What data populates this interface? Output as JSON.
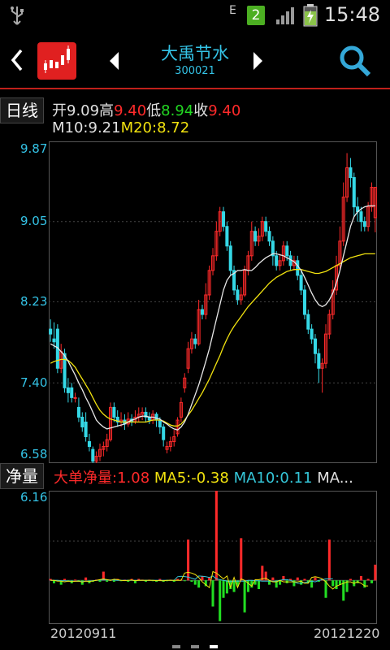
{
  "status": {
    "network": "E",
    "sim_badge": "2",
    "time": "15:48"
  },
  "header": {
    "stock_name": "大禹节水",
    "stock_code": "300021"
  },
  "ohlc": {
    "period_label": "日线",
    "open_label": "开",
    "open_value": "9.09",
    "high_label": "高",
    "high_value": "9.40",
    "low_label": "低",
    "low_value": "8.94",
    "close_label": "收",
    "close_value": "9.40",
    "ma10_label": "M10:",
    "ma10_value": "9.21",
    "ma20_label": "M20:",
    "ma20_value": "8.72"
  },
  "price_axis": {
    "ticks": [
      "9.87",
      "9.05",
      "8.23",
      "7.40",
      "6.58"
    ]
  },
  "volume_panel": {
    "tab_label": "净量",
    "big_order_net": "大单净量:1.08",
    "ma5": "MA5:-0.38",
    "ma10": "MA10:0.11",
    "more": "MA...",
    "top_tick": "6.16"
  },
  "dates": {
    "start": "20120911",
    "end": "20121220"
  },
  "colors": {
    "accent_red": "#c0201b",
    "up_red": "#ff2a2a",
    "down_cyan": "#35d8e6",
    "ma10_white": "#e8e8e8",
    "ma20_yellow": "#f1e20f",
    "vol_green": "#22dd22"
  },
  "chart_data": {
    "type": "candlestick",
    "ylim": [
      6.58,
      9.87
    ],
    "candles": [
      [
        7.95,
        7.9,
        8.05,
        7.82
      ],
      [
        7.85,
        7.82,
        8.02,
        7.75
      ],
      [
        7.95,
        7.55,
        8.0,
        7.5
      ],
      [
        7.55,
        7.72,
        7.8,
        7.5
      ],
      [
        7.7,
        7.35,
        7.75,
        7.3
      ],
      [
        7.35,
        7.3,
        7.45,
        7.2
      ],
      [
        7.35,
        7.25,
        7.4,
        7.2
      ],
      [
        7.25,
        7.25,
        7.3,
        7.2
      ],
      [
        7.15,
        7.05,
        7.25,
        7.0
      ],
      [
        7.05,
        6.95,
        7.1,
        6.9
      ],
      [
        7.0,
        6.85,
        7.1,
        6.8
      ],
      [
        6.8,
        6.75,
        6.88,
        6.7
      ],
      [
        6.72,
        6.6,
        6.75,
        6.55
      ],
      [
        6.6,
        6.65,
        6.7,
        6.55
      ],
      [
        6.65,
        6.72,
        6.78,
        6.6
      ],
      [
        6.72,
        6.75,
        6.8,
        6.65
      ],
      [
        6.75,
        6.82,
        6.88,
        6.7
      ],
      [
        6.82,
        7.15,
        7.2,
        6.8
      ],
      [
        7.15,
        7.05,
        7.2,
        7.0
      ],
      [
        7.05,
        7.0,
        7.12,
        6.95
      ],
      [
        7.0,
        7.02,
        7.1,
        6.95
      ],
      [
        7.02,
        6.98,
        7.08,
        6.92
      ],
      [
        6.98,
        7.03,
        7.1,
        6.95
      ],
      [
        7.03,
        7.0,
        7.08,
        6.96
      ],
      [
        7.0,
        7.05,
        7.12,
        6.98
      ],
      [
        7.05,
        7.08,
        7.15,
        7.0
      ],
      [
        7.08,
        7.1,
        7.15,
        7.02
      ],
      [
        7.1,
        7.05,
        7.15,
        7.0
      ],
      [
        7.05,
        7.02,
        7.1,
        6.98
      ],
      [
        7.02,
        7.08,
        7.12,
        6.98
      ],
      [
        7.08,
        7.02,
        7.1,
        6.95
      ],
      [
        7.02,
        6.95,
        7.05,
        6.88
      ],
      [
        6.95,
        6.82,
        6.98,
        6.75
      ],
      [
        6.72,
        6.75,
        6.8,
        6.68
      ],
      [
        6.75,
        6.8,
        6.85,
        6.7
      ],
      [
        6.8,
        6.85,
        6.92,
        6.75
      ],
      [
        6.88,
        7.02,
        7.05,
        6.85
      ],
      [
        7.05,
        7.2,
        7.25,
        7.0
      ],
      [
        7.35,
        7.45,
        7.5,
        7.3
      ],
      [
        7.55,
        7.75,
        7.82,
        7.5
      ],
      [
        7.75,
        7.85,
        7.92,
        7.7
      ],
      [
        7.85,
        7.8,
        7.9,
        7.75
      ],
      [
        7.8,
        8.15,
        8.25,
        7.78
      ],
      [
        8.15,
        8.1,
        8.2,
        8.05
      ],
      [
        8.1,
        8.3,
        8.42,
        8.05
      ],
      [
        8.3,
        8.55,
        8.6,
        8.25
      ],
      [
        8.55,
        8.7,
        8.78,
        8.5
      ],
      [
        8.7,
        8.95,
        9.05,
        8.65
      ],
      [
        8.95,
        9.15,
        9.2,
        8.9
      ],
      [
        9.15,
        9.0,
        9.2,
        8.95
      ],
      [
        9.0,
        8.8,
        9.05,
        8.75
      ],
      [
        8.8,
        8.55,
        8.85,
        8.5
      ],
      [
        8.55,
        8.35,
        8.6,
        8.3
      ],
      [
        8.35,
        8.25,
        8.4,
        8.2
      ],
      [
        8.25,
        8.3,
        8.38,
        8.2
      ],
      [
        8.3,
        8.55,
        8.6,
        8.28
      ],
      [
        8.55,
        8.7,
        8.75,
        8.5
      ],
      [
        8.7,
        8.95,
        9.05,
        8.65
      ],
      [
        8.95,
        8.85,
        9.0,
        8.8
      ],
      [
        8.85,
        8.9,
        8.98,
        8.8
      ],
      [
        8.9,
        9.05,
        9.1,
        8.85
      ],
      [
        9.05,
        8.95,
        9.1,
        8.9
      ],
      [
        8.95,
        8.85,
        9.0,
        8.8
      ],
      [
        8.85,
        8.7,
        8.9,
        8.6
      ],
      [
        8.7,
        8.6,
        8.75,
        8.55
      ],
      [
        8.6,
        8.65,
        8.72,
        8.55
      ],
      [
        8.65,
        8.8,
        8.85,
        8.6
      ],
      [
        8.8,
        8.7,
        8.85,
        8.65
      ],
      [
        8.7,
        8.6,
        8.75,
        8.55
      ],
      [
        8.6,
        8.65,
        8.7,
        8.55
      ],
      [
        8.65,
        8.5,
        8.7,
        8.45
      ],
      [
        8.5,
        8.35,
        8.55,
        8.3
      ],
      [
        8.35,
        8.1,
        8.4,
        8.05
      ],
      [
        8.1,
        7.95,
        8.15,
        7.9
      ],
      [
        7.95,
        7.85,
        8.0,
        7.8
      ],
      [
        7.85,
        7.7,
        7.9,
        7.6
      ],
      [
        7.7,
        7.55,
        7.75,
        7.4
      ],
      [
        7.55,
        7.6,
        7.65,
        7.3
      ],
      [
        7.6,
        7.9,
        8.0,
        7.55
      ],
      [
        7.9,
        8.1,
        8.15,
        7.85
      ],
      [
        8.1,
        8.35,
        8.45,
        8.05
      ],
      [
        8.35,
        8.6,
        8.7,
        8.3
      ],
      [
        8.6,
        8.85,
        9.0,
        8.55
      ],
      [
        8.85,
        9.3,
        9.45,
        8.8
      ],
      [
        9.3,
        9.6,
        9.75,
        9.25
      ],
      [
        9.6,
        9.5,
        9.7,
        9.4
      ],
      [
        9.5,
        9.2,
        9.55,
        9.1
      ],
      [
        9.2,
        9.15,
        9.3,
        9.05
      ],
      [
        9.15,
        9.05,
        9.2,
        8.95
      ],
      [
        9.05,
        9.0,
        9.1,
        8.95
      ],
      [
        9.0,
        9.2,
        9.25,
        8.95
      ],
      [
        9.2,
        9.4,
        9.45,
        9.15
      ],
      [
        9.09,
        9.4,
        9.4,
        8.94
      ]
    ],
    "ma10": [
      7.8,
      7.78,
      7.76,
      7.72,
      7.68,
      7.62,
      7.55,
      7.48,
      7.4,
      7.33,
      7.25,
      7.18,
      7.1,
      7.02,
      6.98,
      6.95,
      6.93,
      6.94,
      6.95,
      6.96,
      6.97,
      6.98,
      7.0,
      7.02,
      7.03,
      7.05,
      7.06,
      7.06,
      7.05,
      7.05,
      7.04,
      7.03,
      7.0,
      6.98,
      6.95,
      6.93,
      6.92,
      6.95,
      7.0,
      7.08,
      7.18,
      7.28,
      7.38,
      7.5,
      7.62,
      7.75,
      7.9,
      8.05,
      8.2,
      8.35,
      8.45,
      8.5,
      8.52,
      8.55,
      8.55,
      8.56,
      8.55,
      8.55,
      8.58,
      8.62,
      8.65,
      8.68,
      8.7,
      8.72,
      8.72,
      8.71,
      8.7,
      8.68,
      8.66,
      8.64,
      8.6,
      8.55,
      8.48,
      8.4,
      8.32,
      8.25,
      8.2,
      8.18,
      8.2,
      8.25,
      8.32,
      8.42,
      8.55,
      8.7,
      8.85,
      9.0,
      9.1,
      9.15,
      9.18,
      9.2,
      9.21,
      9.21,
      9.21
    ],
    "ma20": [
      7.6,
      7.62,
      7.63,
      7.64,
      7.64,
      7.63,
      7.6,
      7.56,
      7.5,
      7.44,
      7.38,
      7.32,
      7.25,
      7.18,
      7.12,
      7.08,
      7.05,
      7.03,
      7.02,
      7.01,
      7.0,
      7.0,
      7.0,
      7.0,
      7.0,
      7.0,
      7.0,
      7.0,
      7.01,
      7.02,
      7.02,
      7.02,
      7.01,
      6.99,
      6.97,
      6.96,
      6.96,
      6.98,
      7.02,
      7.07,
      7.12,
      7.18,
      7.24,
      7.3,
      7.37,
      7.44,
      7.52,
      7.6,
      7.68,
      7.77,
      7.85,
      7.92,
      7.98,
      8.03,
      8.08,
      8.13,
      8.18,
      8.22,
      8.26,
      8.3,
      8.34,
      8.38,
      8.42,
      8.45,
      8.48,
      8.5,
      8.52,
      8.54,
      8.55,
      8.56,
      8.56,
      8.56,
      8.55,
      8.54,
      8.53,
      8.52,
      8.52,
      8.53,
      8.54,
      8.56,
      8.58,
      8.6,
      8.62,
      8.64,
      8.66,
      8.68,
      8.69,
      8.7,
      8.71,
      8.72,
      8.72,
      8.72,
      8.72
    ],
    "volume": {
      "ylim": [
        -3.0,
        6.16
      ],
      "net": [
        0.1,
        -0.2,
        0.0,
        -0.3,
        0.1,
        -0.1,
        -0.2,
        0.05,
        -0.1,
        -0.3,
        0.2,
        -0.2,
        -0.1,
        0.05,
        -0.1,
        0.6,
        -0.1,
        0.05,
        -0.1,
        0.1,
        -0.05,
        0.05,
        -0.1,
        0.1,
        -0.2,
        0.1,
        0.05,
        -0.1,
        0.05,
        -0.05,
        -0.1,
        0.1,
        -0.1,
        -0.05,
        0.05,
        -0.1,
        0.1,
        0.05,
        -0.05,
        2.8,
        -0.1,
        -0.3,
        -0.5,
        0.3,
        -0.4,
        0.2,
        -1.8,
        6.16,
        -2.8,
        -1.2,
        -0.9,
        -0.6,
        -0.8,
        -0.4,
        2.9,
        -2.2,
        -0.8,
        -0.5,
        -0.3,
        -0.6,
        1.0,
        0.6,
        -0.3,
        0.2,
        -0.5,
        -0.3,
        0.3,
        -0.2,
        0.1,
        -0.4,
        0.2,
        -0.3,
        0.1,
        -0.2,
        -0.5,
        0.2,
        -0.1,
        0.1,
        -1.2,
        2.8,
        -0.4,
        -0.6,
        -0.3,
        -1.4,
        -0.8,
        0.1,
        -0.4,
        -0.2,
        0.3,
        -0.5,
        0.1,
        -0.2,
        1.08
      ],
      "ma5": [
        0.0,
        0.0,
        -0.05,
        -0.05,
        -0.1,
        -0.05,
        -0.08,
        -0.06,
        -0.05,
        -0.12,
        -0.05,
        -0.08,
        -0.04,
        0.0,
        0.05,
        0.1,
        0.05,
        0.0,
        0.08,
        0.05,
        0.0,
        -0.02,
        0.0,
        0.02,
        -0.03,
        0.0,
        0.0,
        0.0,
        0.0,
        0.0,
        -0.02,
        -0.02,
        -0.03,
        0.0,
        0.0,
        0.0,
        0.0,
        0.0,
        0.5,
        0.55,
        0.5,
        0.4,
        0.2,
        -0.1,
        -0.3,
        -0.5,
        0.6,
        0.5,
        0.3,
        0.1,
        0.3,
        -0.5,
        0.2,
        -0.5,
        0.1,
        0.0,
        -0.2,
        -0.4,
        0.05,
        0.05,
        0.1,
        0.15,
        0.0,
        -0.1,
        -0.1,
        0.0,
        -0.1,
        -0.1,
        -0.1,
        -0.1,
        -0.1,
        -0.05,
        -0.2,
        -0.2,
        0.2,
        0.25,
        0.2,
        0.1,
        -0.1,
        -0.4,
        -0.6,
        -0.4,
        -0.3,
        -0.2,
        -0.1,
        -0.1,
        -0.2,
        -0.1,
        -0.2,
        -0.38,
        -0.38
      ],
      "ma10": [
        0.0,
        0.0,
        0.0,
        -0.03,
        -0.03,
        -0.05,
        -0.05,
        -0.06,
        -0.06,
        -0.08,
        -0.06,
        -0.05,
        -0.03,
        0.0,
        0.02,
        0.03,
        0.03,
        0.03,
        0.02,
        0.0,
        0.0,
        0.0,
        0.0,
        0.0,
        0.0,
        0.0,
        0.0,
        0.0,
        0.0,
        0.0,
        0.0,
        0.0,
        0.0,
        0.0,
        0.0,
        0.0,
        0.25,
        0.28,
        0.26,
        0.22,
        0.15,
        0.08,
        0.3,
        0.28,
        0.25,
        0.2,
        0.3,
        0.1,
        0.05,
        0.0,
        -0.05,
        -0.08,
        -0.05,
        -0.05,
        -0.05,
        -0.05,
        0.0,
        0.0,
        -0.02,
        -0.03,
        -0.05,
        -0.05,
        -0.05,
        -0.06,
        -0.05,
        0.0,
        0.05,
        0.05,
        0.0,
        -0.1,
        -0.2,
        -0.2,
        -0.15,
        -0.1,
        -0.05,
        -0.1,
        0.0,
        0.05,
        0.1,
        0.1,
        0.11
      ]
    }
  }
}
